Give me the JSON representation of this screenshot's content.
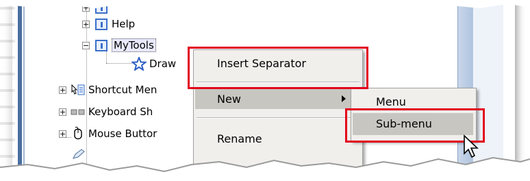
{
  "tree": {
    "items": [
      {
        "label": "Help",
        "icon": "toolbar-icon"
      },
      {
        "label": "MyTools",
        "icon": "toolbar-icon"
      },
      {
        "label": "Draw",
        "icon": "star-icon"
      },
      {
        "label": "Shortcut Men",
        "icon": "shortcut-menu-icon"
      },
      {
        "label": "Keyboard Sh",
        "icon": "keyboard-icon"
      },
      {
        "label": "Mouse Buttor",
        "icon": "mouse-icon"
      }
    ]
  },
  "context_menu": {
    "items": [
      {
        "label": "Insert Separator"
      },
      {
        "label": "New",
        "has_submenu": true
      },
      {
        "label": "Rename"
      }
    ]
  },
  "submenu": {
    "items": [
      {
        "label": "Menu"
      },
      {
        "label": "Sub-menu"
      }
    ]
  },
  "colors": {
    "highlight_box": "#e3001b",
    "menu_bg": "#f0efec",
    "menu_hover": "#c7c6c1",
    "toolbar_icon": "#3b6fc9"
  }
}
